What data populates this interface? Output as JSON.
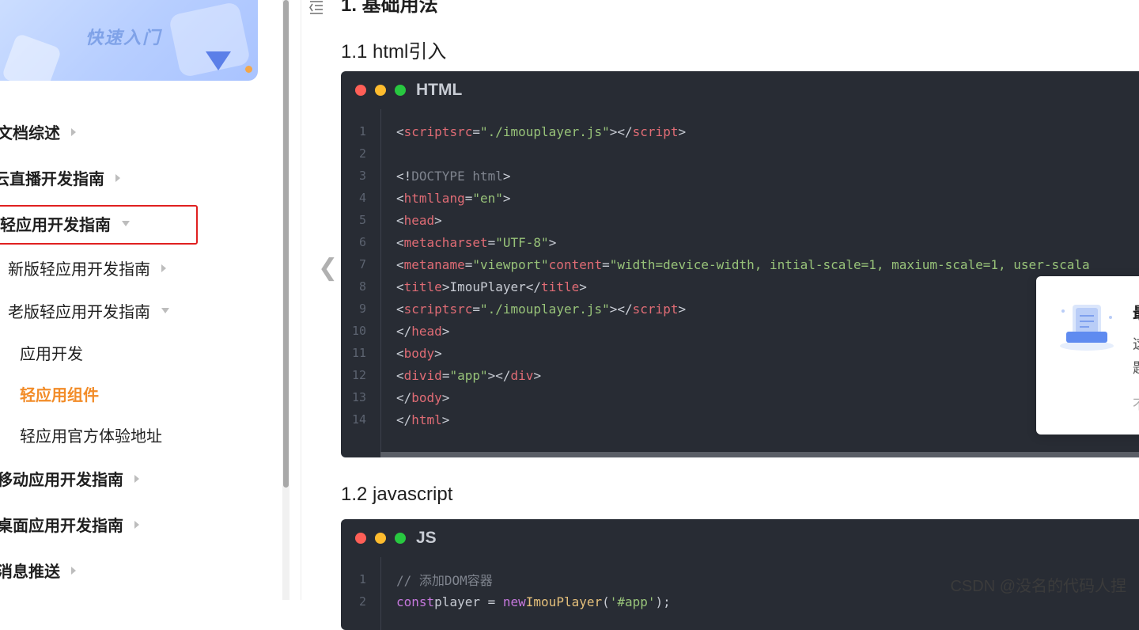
{
  "sidebar": {
    "banner_title": "快速入门",
    "items": [
      {
        "label": "文档综述"
      },
      {
        "label": "云直播开发指南"
      },
      {
        "label": "轻应用开发指南"
      },
      {
        "label": "新版轻应用开发指南"
      },
      {
        "label": "老版轻应用开发指南"
      },
      {
        "label": "应用开发"
      },
      {
        "label": "轻应用组件"
      },
      {
        "label": "轻应用官方体验地址"
      },
      {
        "label": "移动应用开发指南"
      },
      {
        "label": "桌面应用开发指南"
      },
      {
        "label": "消息推送"
      }
    ],
    "highlight_color": "#e02020",
    "active_color": "#f28c28"
  },
  "main": {
    "section_top": "1. 基础用法",
    "section_html": "1.1 html引入",
    "section_js": "1.2 javascript",
    "html_block": {
      "lang": "HTML",
      "line_numbers": [
        "1",
        "2",
        "3",
        "4",
        "5",
        "6",
        "7",
        "8",
        "9",
        "10",
        "11",
        "12",
        "13",
        "14"
      ]
    },
    "js_block": {
      "lang": "JS",
      "line_numbers": [
        "1",
        "2"
      ]
    }
  },
  "popup": {
    "heading": "最",
    "text1": "这",
    "text2": "题",
    "text3": "不"
  },
  "watermark": "CSDN @没名的代码人捏"
}
